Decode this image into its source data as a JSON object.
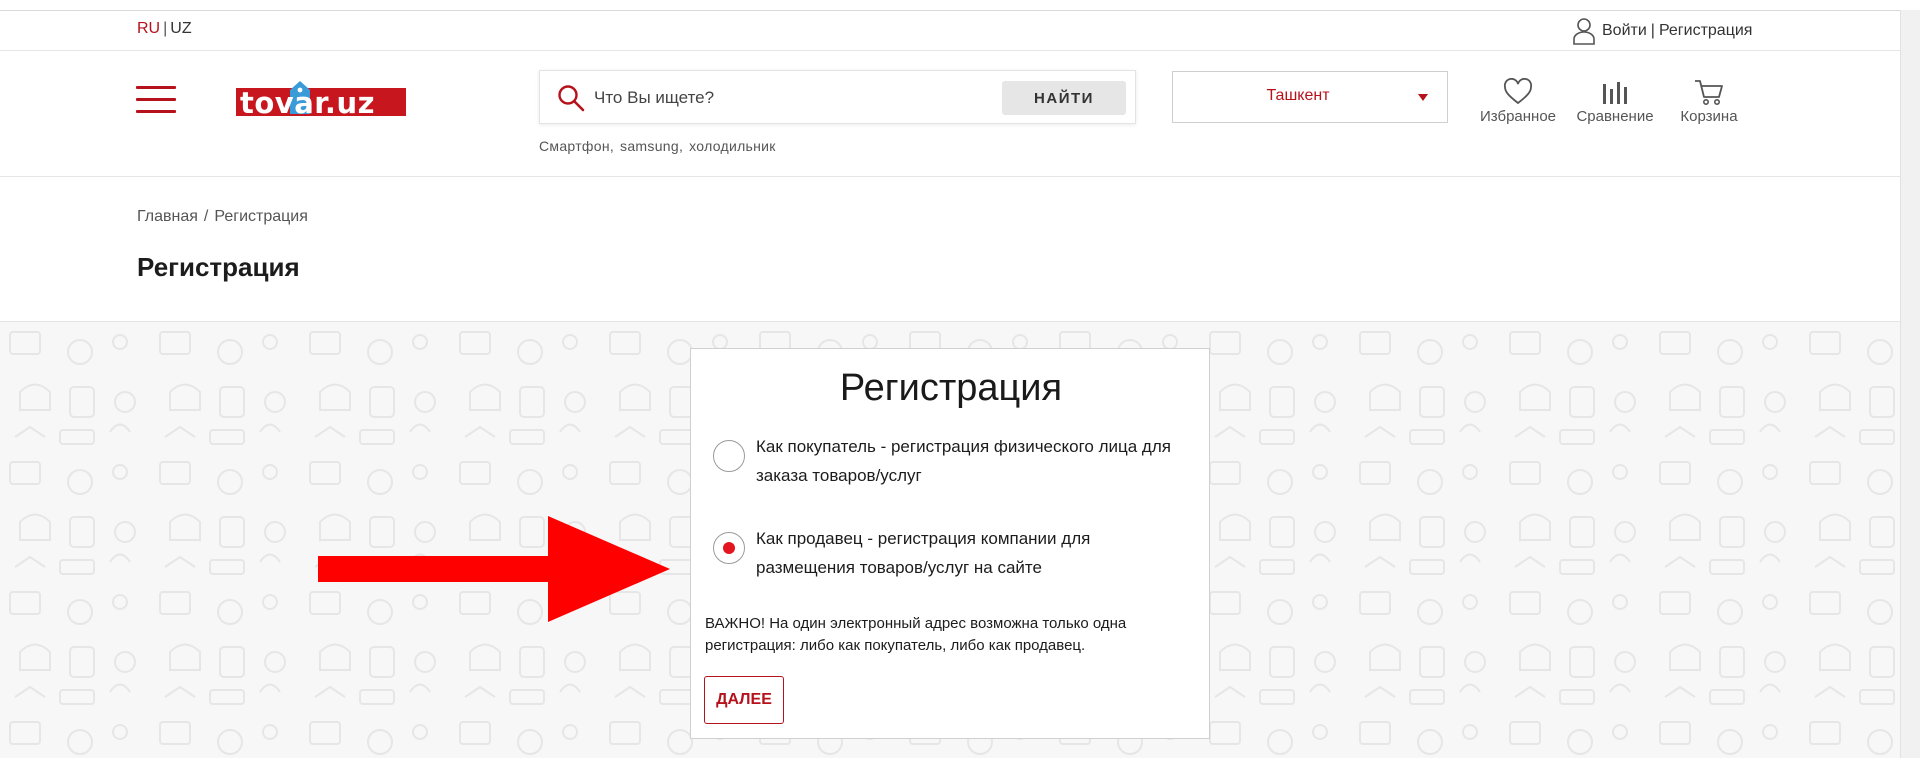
{
  "topbar": {
    "lang_ru": "RU",
    "lang_sep": "|",
    "lang_uz": "UZ",
    "login": "Войти",
    "account_sep": "|",
    "register": "Регистрация"
  },
  "header": {
    "logo_text": "tovar.uz",
    "search_placeholder": "Что Вы ищете?",
    "search_button": "НАЙТИ",
    "hints": [
      "Смартфон,",
      "samsung,",
      "холодильник"
    ],
    "city": "Ташкент",
    "favorites": "Избранное",
    "compare": "Сравнение",
    "cart": "Корзина"
  },
  "breadcrumb": {
    "home": "Главная",
    "sep": "/",
    "current": "Регистрация"
  },
  "page_title": "Регистрация",
  "card": {
    "title": "Регистрация",
    "option_buyer": "Как покупатель - регистрация физического лица для заказа товаров/услуг",
    "option_seller": "Как продавец - регистрация компании для размещения товаров/услуг на сайте",
    "selected": "seller",
    "note": "ВАЖНО! На один электронный адрес возможна только одна регистрация: либо как покупатель, либо как продавец.",
    "next_button": "ДАЛЕЕ"
  },
  "colors": {
    "brand_red": "#b5121b",
    "radio_red": "#e3161f",
    "arrow_red": "#ff0000"
  },
  "icons": [
    "hamburger-icon",
    "search-icon",
    "user-icon",
    "heart-icon",
    "compare-icon",
    "cart-icon",
    "price-tag-icon",
    "arrow-pointer"
  ]
}
